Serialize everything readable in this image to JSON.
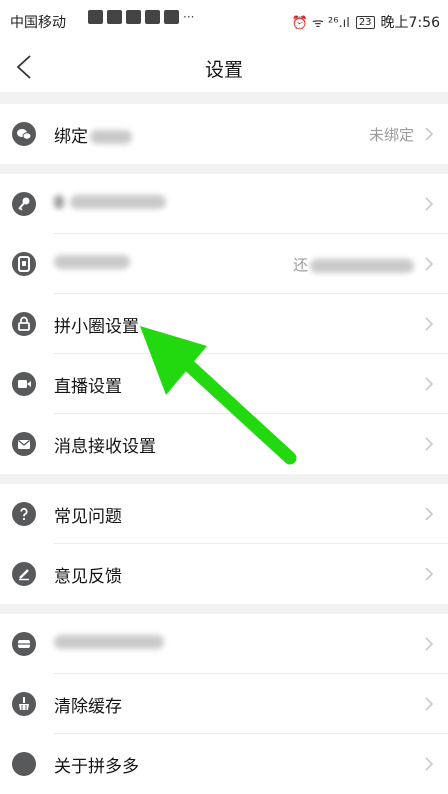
{
  "status_bar": {
    "carrier": "中国移动",
    "more": "···",
    "signal": "⏰ ᯤ ²⁶.ıl",
    "battery": "23",
    "time": "晚上7:56"
  },
  "nav": {
    "title": "设置"
  },
  "groups": [
    {
      "rows": [
        {
          "label": "绑定",
          "value": "未绑定"
        }
      ]
    },
    {
      "rows": [
        {
          "label": ""
        },
        {
          "label": "",
          "value": "还"
        },
        {
          "label": "拼小圈设置"
        },
        {
          "label": "直播设置"
        },
        {
          "label": "消息接收设置"
        }
      ]
    },
    {
      "rows": [
        {
          "label": "常见问题"
        },
        {
          "label": "意见反馈"
        }
      ]
    },
    {
      "rows": [
        {
          "label": ""
        },
        {
          "label": "清除缓存"
        },
        {
          "label": "关于拼多多"
        }
      ]
    }
  ],
  "colors": {
    "icon": "#58595b",
    "arrow": "#22d80f",
    "background": "#f2f2f2"
  }
}
